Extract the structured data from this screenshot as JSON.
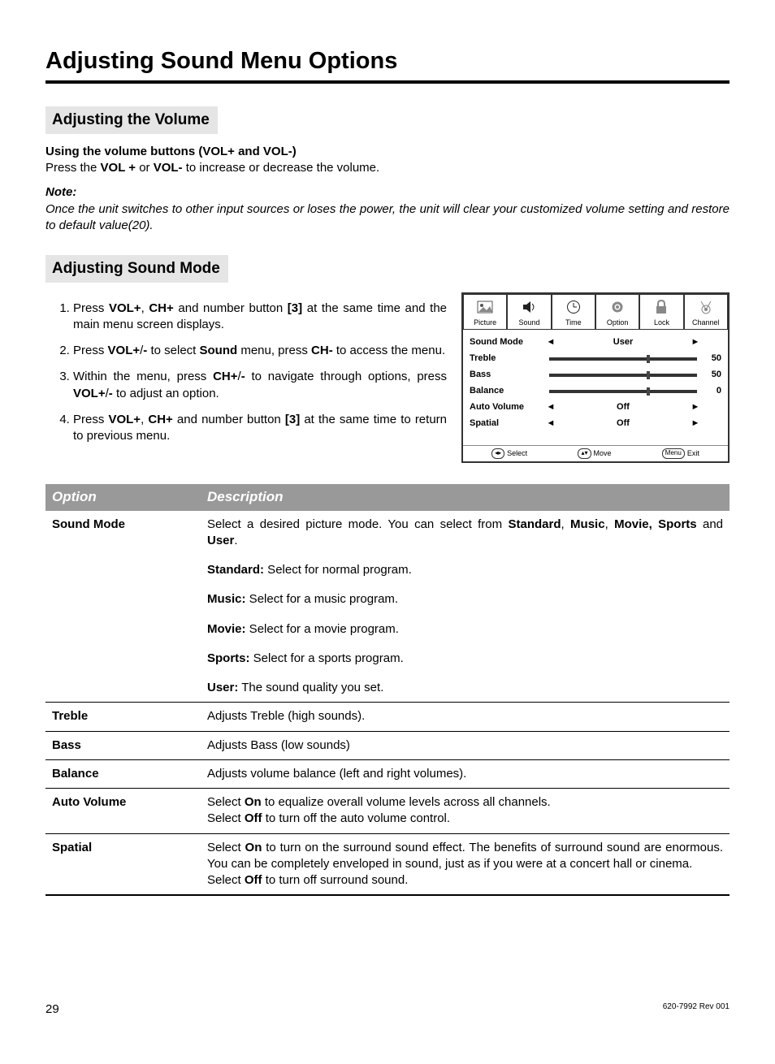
{
  "title": "Adjusting Sound Menu Options",
  "sec1": {
    "heading": "Adjusting the Volume",
    "sub": "Using the volume buttons (VOL+ and VOL-)",
    "line_pre": "Press the ",
    "line_b1": "VOL +",
    "line_mid": " or ",
    "line_b2": "VOL-",
    "line_post": " to increase or decrease the volume.",
    "note_label": "Note:",
    "note_body": "Once the unit switches to other input sources or loses the power, the unit will clear your customized volume setting and restore to default value(20)."
  },
  "sec2": {
    "heading": "Adjusting Sound Mode",
    "steps": {
      "s1_a": "Press ",
      "s1_b1": "VOL+",
      "s1_b": ", ",
      "s1_b2": "CH+",
      "s1_c": " and number button ",
      "s1_b3": "[3]",
      "s1_d": " at the same time and the main menu screen displays.",
      "s2_a": "Press ",
      "s2_b1": "VOL+",
      "s2_b": "/",
      "s2_b2": "-",
      "s2_c": " to select ",
      "s2_b3": "Sound",
      "s2_d": " menu, press ",
      "s2_b4": "CH-",
      "s2_e": " to access the menu.",
      "s3_a": "Within the menu, press ",
      "s3_b1": "CH+",
      "s3_b": "/",
      "s3_b2": "-",
      "s3_c": "  to navigate through options, press ",
      "s3_b3": "VOL+",
      "s3_d": "/",
      "s3_b4": "-",
      "s3_e": " to adjust an option.",
      "s4_a": "Press ",
      "s4_b1": "VOL+",
      "s4_b": ", ",
      "s4_b2": "CH+",
      "s4_c": " and number button ",
      "s4_b3": "[3]",
      "s4_d": " at the same time to return to previous menu."
    }
  },
  "menu": {
    "tabs": [
      "Picture",
      "Sound",
      "Time",
      "Option",
      "Lock",
      "Channel"
    ],
    "rows": {
      "sound_mode": {
        "label": "Sound Mode",
        "value": "User"
      },
      "treble": {
        "label": "Treble",
        "value": "50",
        "pos": 66
      },
      "bass": {
        "label": "Bass",
        "value": "50",
        "pos": 66
      },
      "balance": {
        "label": "Balance",
        "value": "0",
        "pos": 66
      },
      "auto_volume": {
        "label": "Auto Volume",
        "value": "Off"
      },
      "spatial": {
        "label": "Spatial",
        "value": "Off"
      }
    },
    "footer": {
      "select": "Select",
      "move": "Move",
      "menu": "Menu",
      "exit": "Exit"
    }
  },
  "table": {
    "h1": "Option",
    "h2": "Description",
    "r1": {
      "name": "Sound Mode",
      "intro_a": "Select a desired picture mode. You can select from ",
      "intro_b1": "Standard",
      "intro_c1": ", ",
      "intro_b2": "Music",
      "intro_c2": ", ",
      "intro_b3": "Movie, Sports",
      "intro_c3": " and ",
      "intro_b4": "User",
      "intro_c4": ".",
      "m1b": "Standard:",
      "m1": " Select for normal program.",
      "m2b": "Music:",
      "m2": " Select for a music program.",
      "m3b": "Movie:",
      "m3": " Select for a movie program.",
      "m4b": "Sports:",
      "m4": " Select for a sports program.",
      "m5b": "User:",
      "m5": " The sound quality you set."
    },
    "r2": {
      "name": "Treble",
      "desc": "Adjusts Treble (high sounds)."
    },
    "r3": {
      "name": "Bass",
      "desc": "Adjusts Bass (low sounds)"
    },
    "r4": {
      "name": "Balance",
      "desc": "Adjusts volume balance (left and right volumes)."
    },
    "r5": {
      "name": "Auto Volume",
      "l1a": "Select ",
      "l1b": "On",
      "l1c": " to equalize overall volume levels across all channels.",
      "l2a": "Select ",
      "l2b": "Off",
      "l2c": " to turn off the auto volume control."
    },
    "r6": {
      "name": "Spatial",
      "l1a": "Select ",
      "l1b": "On",
      "l1c": " to turn on the surround sound effect. The benefits of surround sound are enormous.  You can be completely enveloped in sound, just as if you were at a concert hall or cinema.",
      "l2a": "Select ",
      "l2b": "Off",
      "l2c": " to turn off surround sound."
    }
  },
  "footer": {
    "page": "29",
    "rev": "620-7992 Rev 001"
  }
}
